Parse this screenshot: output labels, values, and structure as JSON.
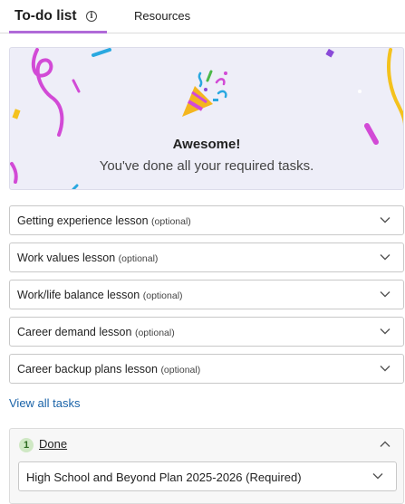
{
  "tabs": {
    "todo_label": "To-do list",
    "info_glyph": "i",
    "resources_label": "Resources"
  },
  "banner": {
    "title": "Awesome!",
    "subtitle": "You've done all your required tasks.",
    "icon": "party-popper-icon"
  },
  "tasks": [
    {
      "name": "Getting experience lesson",
      "tag": "(optional)"
    },
    {
      "name": "Work values lesson",
      "tag": "(optional)"
    },
    {
      "name": "Work/life balance lesson",
      "tag": "(optional)"
    },
    {
      "name": "Career demand lesson",
      "tag": "(optional)"
    },
    {
      "name": "Career backup plans lesson",
      "tag": "(optional)"
    }
  ],
  "view_all_label": "View all tasks",
  "done": {
    "count": "1",
    "label": "Done",
    "items": [
      {
        "name": "High School and Beyond Plan 2025-2026 (Required)"
      }
    ]
  },
  "colors": {
    "tab_accent": "#b06ad8",
    "link": "#1a63a8",
    "banner_bg": "#eeeef8",
    "done_badge_bg": "#cfe8c4"
  }
}
